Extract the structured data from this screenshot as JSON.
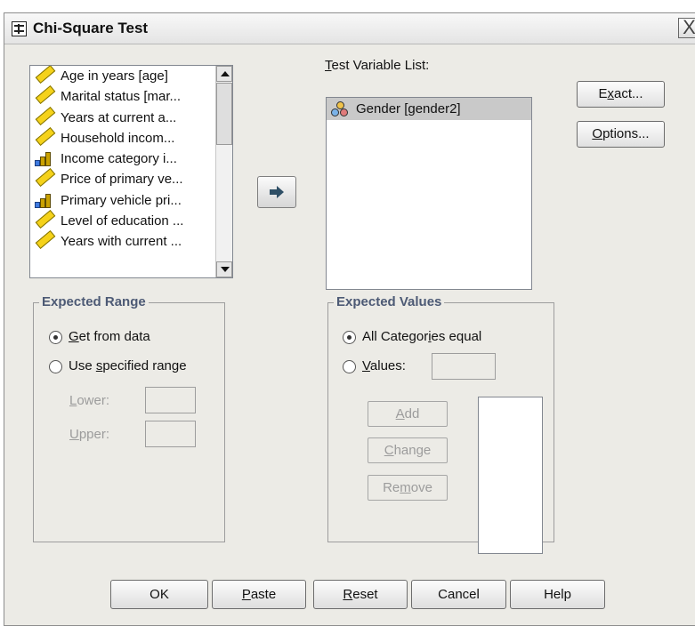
{
  "window": {
    "title": "Chi-Square Test",
    "close_label": "X"
  },
  "source_list": {
    "items": [
      {
        "label": "Age in years [age]",
        "icon": "scale-icon"
      },
      {
        "label": "Marital status [mar...",
        "icon": "scale-icon"
      },
      {
        "label": "Years at current a...",
        "icon": "scale-icon"
      },
      {
        "label": "Household incom...",
        "icon": "scale-icon"
      },
      {
        "label": "Income category i...",
        "icon": "ordinal-icon"
      },
      {
        "label": "Price of primary ve...",
        "icon": "scale-icon"
      },
      {
        "label": "Primary vehicle pri...",
        "icon": "ordinal-icon"
      },
      {
        "label": "Level of education ...",
        "icon": "scale-icon"
      },
      {
        "label": "Years with current ...",
        "icon": "scale-icon"
      }
    ]
  },
  "target": {
    "label_lead": "T",
    "label_rest": "est Variable List:",
    "items": [
      {
        "label": "Gender [gender2]",
        "icon": "nominal-icon",
        "selected": true
      }
    ]
  },
  "buttons": {
    "exact": {
      "pre": "E",
      "u": "x",
      "post": "act..."
    },
    "options": {
      "pre": "",
      "u": "O",
      "post": "ptions..."
    }
  },
  "expected_range": {
    "title": "Expected Range",
    "get": {
      "pre": "",
      "u": "G",
      "post": "et from data",
      "checked": true
    },
    "use": {
      "pre": "Use ",
      "u": "s",
      "post": "pecified range",
      "checked": false
    },
    "lower": {
      "pre": "",
      "u": "L",
      "post": "ower:"
    },
    "upper": {
      "pre": "",
      "u": "U",
      "post": "pper:"
    }
  },
  "expected_values": {
    "title": "Expected Values",
    "all": {
      "pre": "All Categor",
      "u": "i",
      "post": "es equal",
      "checked": true
    },
    "values": {
      "pre": "",
      "u": "V",
      "post": "alues:",
      "checked": false
    },
    "add": {
      "pre": "",
      "u": "A",
      "post": "dd"
    },
    "change": {
      "pre": "",
      "u": "C",
      "post": "hange"
    },
    "remove": {
      "pre": "Re",
      "u": "m",
      "post": "ove"
    }
  },
  "bottom": {
    "ok": "OK",
    "paste": {
      "pre": "",
      "u": "P",
      "post": "aste"
    },
    "reset": {
      "pre": "",
      "u": "R",
      "post": "eset"
    },
    "cancel": "Cancel",
    "help": "Help"
  },
  "colors": {
    "dialog_bg": "#ecebe6",
    "group_caption": "#4d5a75",
    "selection": "#c9c9c9"
  }
}
